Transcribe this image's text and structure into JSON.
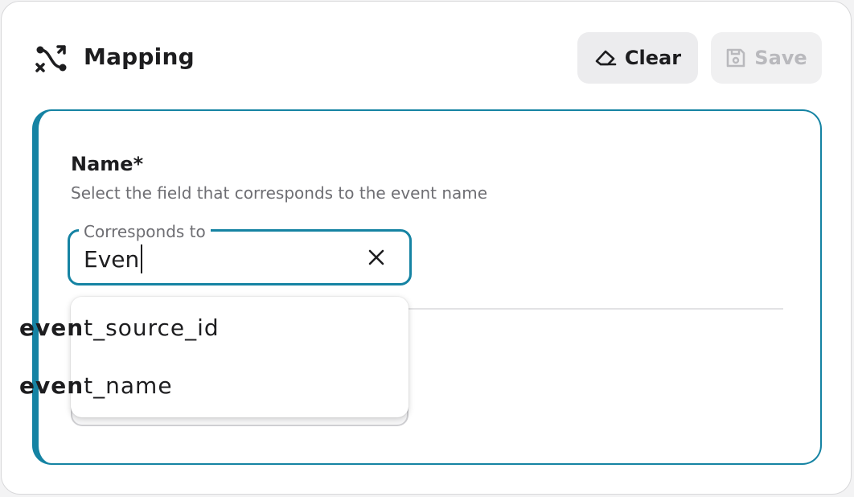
{
  "header": {
    "title": "Mapping",
    "icon": "mapping-route-icon",
    "clear_label": "Clear",
    "save_label": "Save"
  },
  "field": {
    "label": "Name*",
    "description": "Select the field that corresponds to the event name",
    "input_label": "Corresponds to",
    "input_value": "Even"
  },
  "dropdown": {
    "options": [
      {
        "match": "even",
        "rest": "t_source_id"
      },
      {
        "match": "even",
        "rest": "t_name"
      }
    ]
  },
  "colors": {
    "accent": "#1583a3",
    "disabled_text": "#b9b9bd",
    "button_bg": "#ececee"
  }
}
